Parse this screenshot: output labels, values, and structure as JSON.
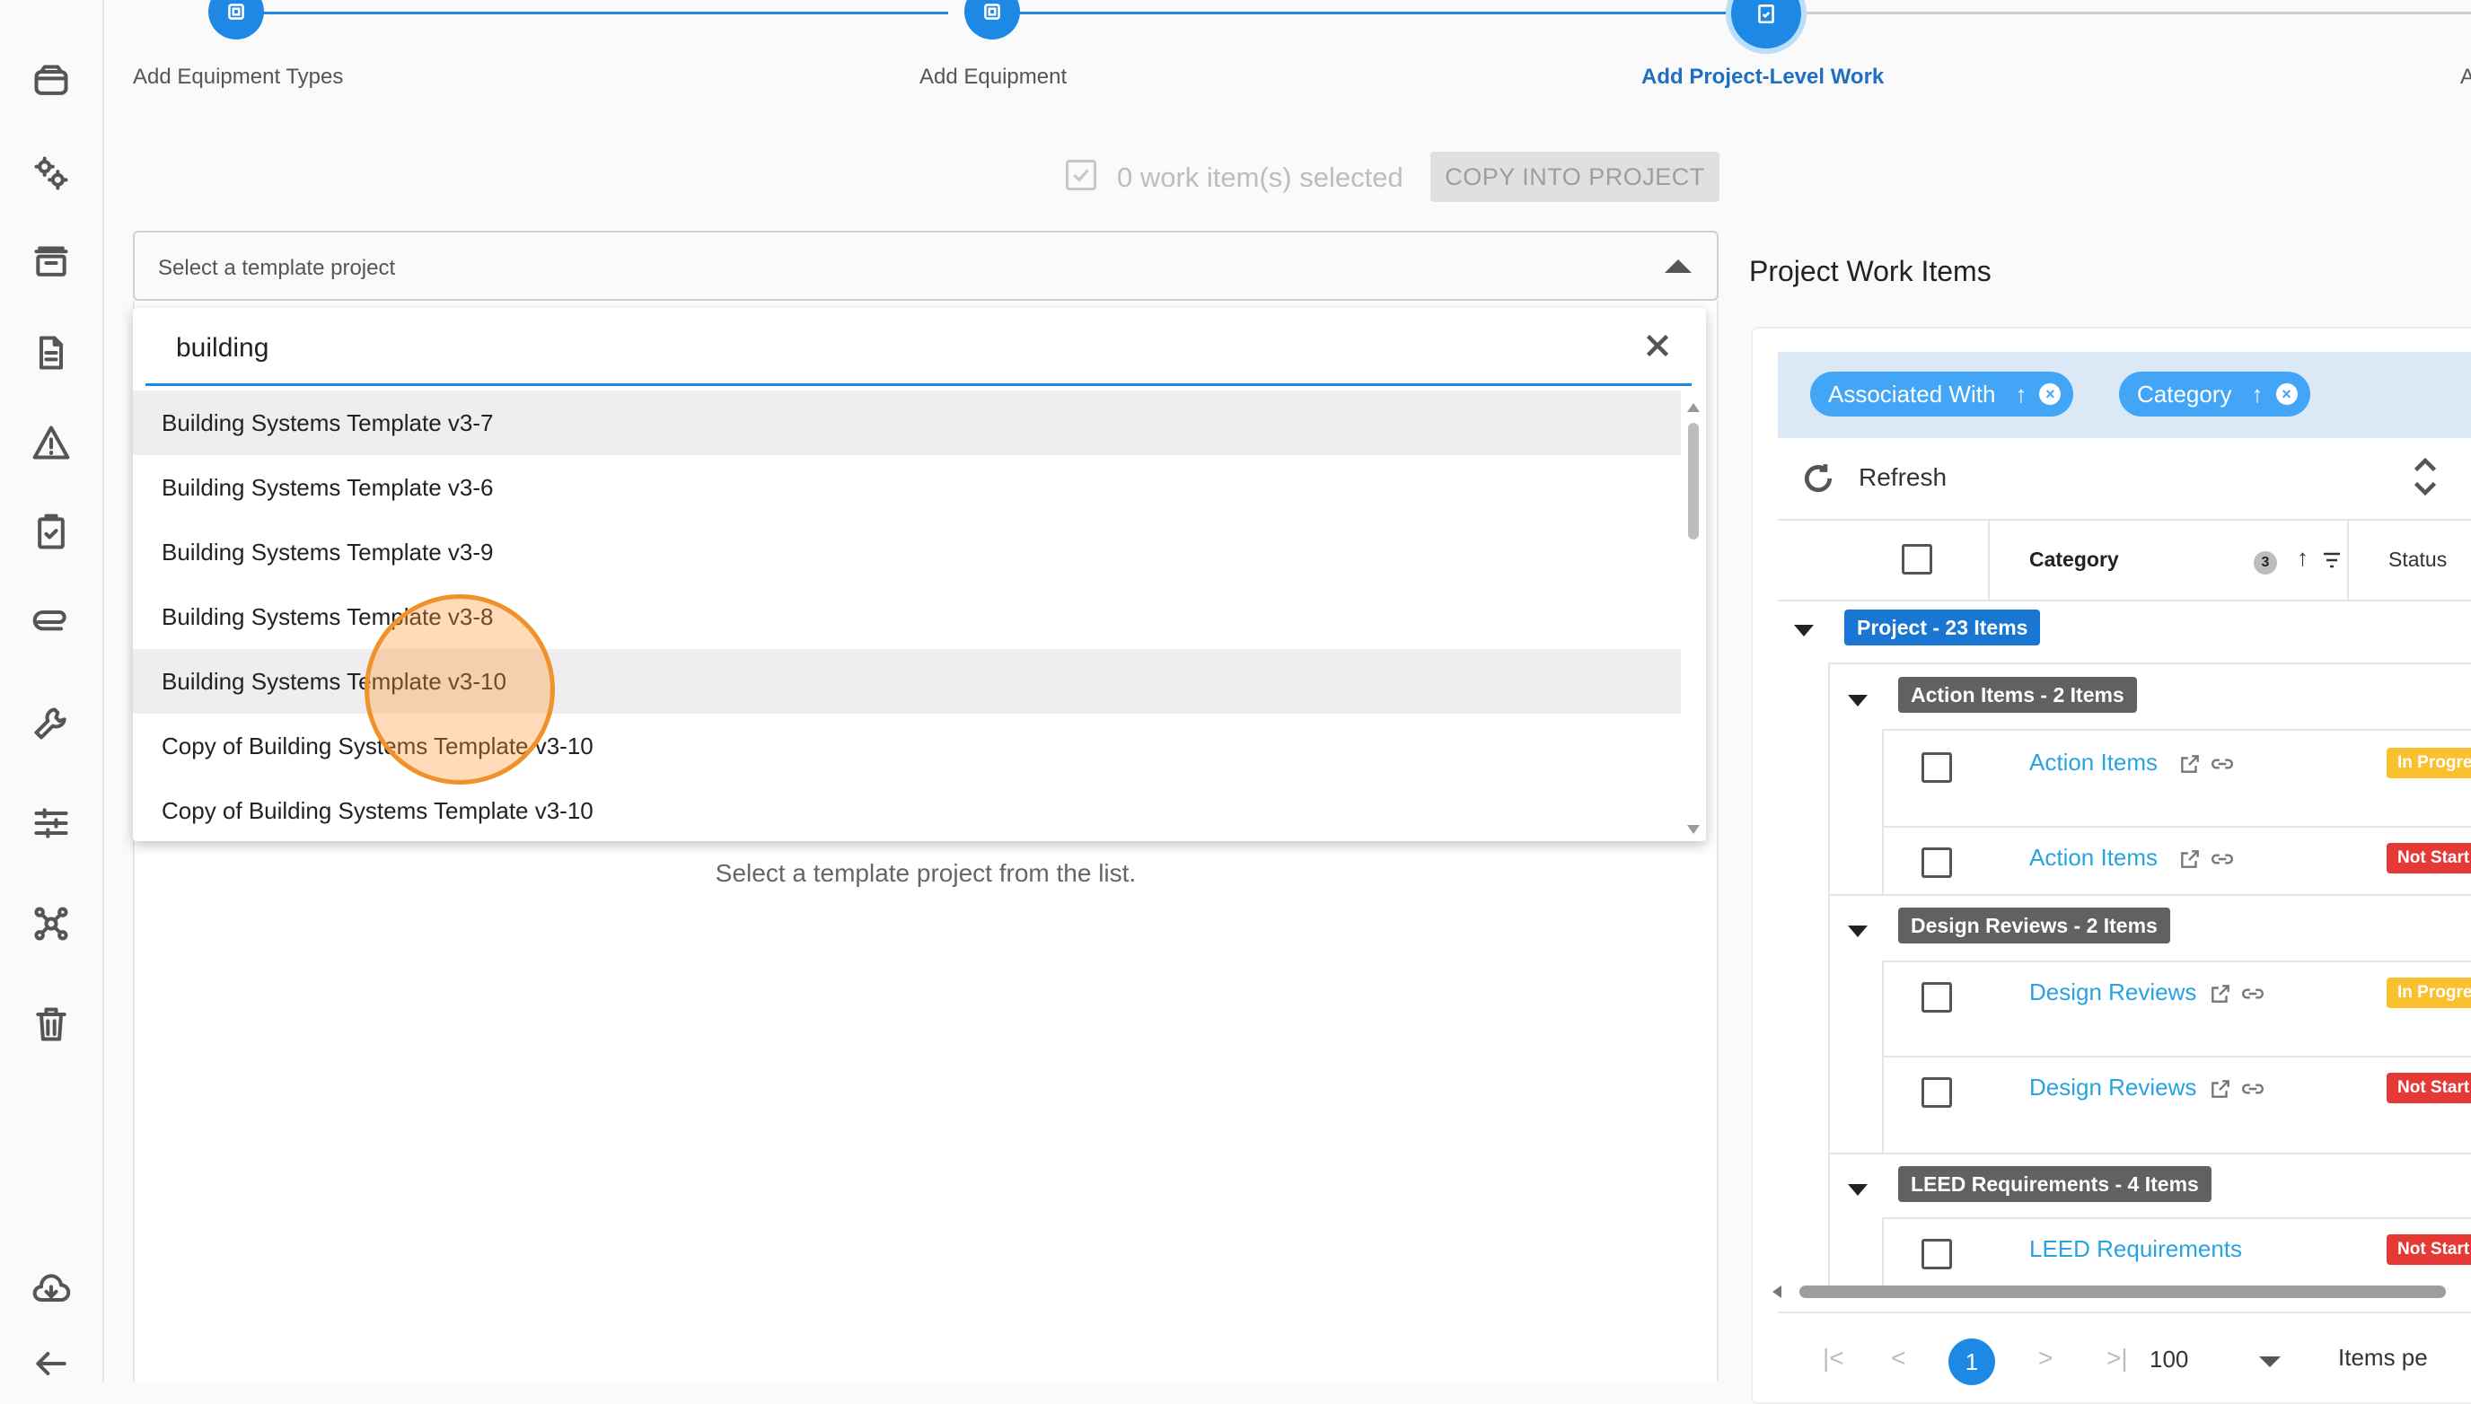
{
  "stepper": {
    "steps": [
      {
        "label": "Add Equipment Types"
      },
      {
        "label": "Add Equipment"
      },
      {
        "label": "Add Project-Level Work"
      },
      {
        "label": "A"
      }
    ],
    "active_color": "#1e88e5"
  },
  "copy_bar": {
    "selected_text": "0 work item(s) selected",
    "copy_label": "COPY INTO PROJECT"
  },
  "template_select": {
    "placeholder": "Select a template project",
    "search_value": "building",
    "options": [
      "Building Systems Template v3-7",
      "Building Systems Template v3-6",
      "Building Systems Template v3-9",
      "Building Systems Template v3-8",
      "Building Systems Template v3-10",
      "Copy of Building Systems Template v3-10",
      "Copy of Building Systems Template v3-10"
    ]
  },
  "left_panel": {
    "empty_message": "Select a template project from the list."
  },
  "right_panel": {
    "title": "Project Work Items",
    "group_chips": [
      {
        "label": "Associated With",
        "sort": "↑"
      },
      {
        "label": "Category",
        "sort": "↑"
      }
    ],
    "refresh_label": "Refresh",
    "header": {
      "category": "Category",
      "sort_count": "3",
      "sort_arrow": "↑",
      "status": "Status"
    },
    "groups": {
      "project": "Project - 23 Items",
      "action": "Action Items - 2 Items",
      "design": "Design Reviews - 2 Items",
      "leed": "LEED Requirements - 4 Items"
    },
    "rows": [
      {
        "name": "Action Items",
        "status": "In Progre"
      },
      {
        "name": "Action Items",
        "status": "Not Start"
      },
      {
        "name": "Design Reviews",
        "status": "In Progre"
      },
      {
        "name": "Design Reviews",
        "status": "Not Start"
      },
      {
        "name": "LEED Requirements",
        "status": "Not Start"
      }
    ],
    "pager": {
      "first": "|<",
      "prev": "<",
      "current": "1",
      "next": ">",
      "last": ">|",
      "page_size": "100",
      "items_label": "Items pe"
    }
  },
  "colors": {
    "primary": "#1e88e5",
    "link": "#29a3df",
    "in_progress": "#fbc02d",
    "not_started": "#e53935",
    "click_highlight": "#f0912c"
  }
}
